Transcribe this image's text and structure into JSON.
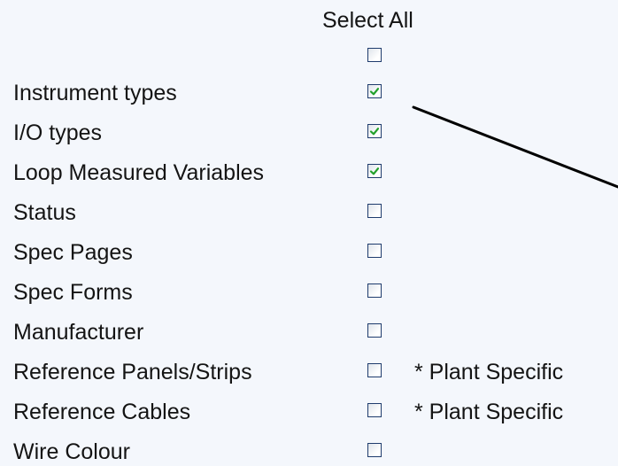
{
  "header": {
    "select_all_label": "Select All"
  },
  "select_all": {
    "checked": false
  },
  "items": [
    {
      "label": "Instrument types",
      "checked": true,
      "note": ""
    },
    {
      "label": "I/O types",
      "checked": true,
      "note": ""
    },
    {
      "label": "Loop Measured Variables",
      "checked": true,
      "note": ""
    },
    {
      "label": "Status",
      "checked": false,
      "note": ""
    },
    {
      "label": "Spec Pages",
      "checked": false,
      "note": ""
    },
    {
      "label": "Spec Forms",
      "checked": false,
      "note": ""
    },
    {
      "label": "Manufacturer",
      "checked": false,
      "note": ""
    },
    {
      "label": "Reference Panels/Strips",
      "checked": false,
      "note": "* Plant Specific"
    },
    {
      "label": "Reference Cables",
      "checked": false,
      "note": "* Plant Specific"
    },
    {
      "label": "Wire Colour",
      "checked": false,
      "note": ""
    }
  ],
  "colors": {
    "background": "#f4f7fc",
    "text": "#141414",
    "checkbox_border": "#1f3c6d",
    "checkmark": "#22a12b",
    "annotation_line": "#000000"
  }
}
